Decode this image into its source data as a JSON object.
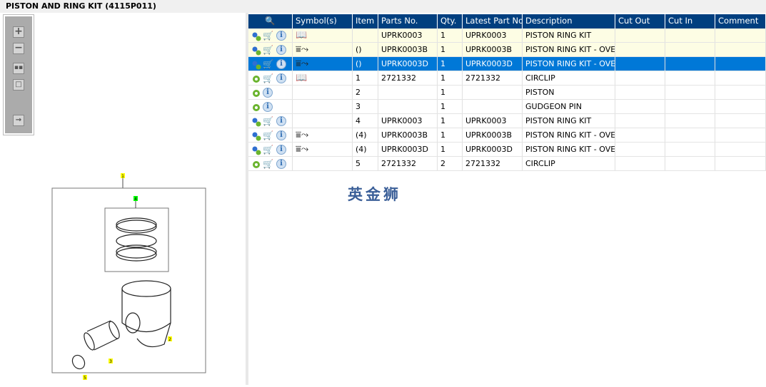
{
  "title": "PISTON AND RING KIT (4115P011)",
  "toolbar": {
    "zoom_in": "+",
    "zoom_out": "−"
  },
  "grid": {
    "columns": [
      "Symbol(s)",
      "Item",
      "Parts No.",
      "Qty.",
      "Latest Part No.",
      "Description",
      "Cut Out",
      "Cut In",
      "Comment"
    ],
    "rows": [
      {
        "icons": "multi",
        "cart": true,
        "symbol": "book",
        "item": "",
        "part": "UPRK0003",
        "qty": "1",
        "latest": "UPRK0003",
        "desc": "PISTON RING KIT",
        "style": "yel"
      },
      {
        "icons": "multi",
        "cart": true,
        "symbol": "alt",
        "item": "()",
        "part": "UPRK0003B",
        "qty": "1",
        "latest": "UPRK0003B",
        "desc": "PISTON RING KIT - OVERSIZE",
        "style": "yel"
      },
      {
        "icons": "multi",
        "cart": true,
        "symbol": "alt",
        "item": "()",
        "part": "UPRK0003D",
        "qty": "1",
        "latest": "UPRK0003D",
        "desc": "PISTON RING KIT - OVERSIZE",
        "style": "sel"
      },
      {
        "icons": "single",
        "cart": true,
        "symbol": "book",
        "item": "1",
        "part": "2721332",
        "qty": "1",
        "latest": "2721332",
        "desc": "CIRCLIP",
        "style": ""
      },
      {
        "icons": "single",
        "cart": false,
        "symbol": "",
        "item": "2",
        "part": "",
        "qty": "1",
        "latest": "",
        "desc": "PISTON",
        "style": ""
      },
      {
        "icons": "single",
        "cart": false,
        "symbol": "",
        "item": "3",
        "part": "",
        "qty": "1",
        "latest": "",
        "desc": "GUDGEON PIN",
        "style": ""
      },
      {
        "icons": "multi",
        "cart": true,
        "symbol": "",
        "item": "4",
        "part": "UPRK0003",
        "qty": "1",
        "latest": "UPRK0003",
        "desc": "PISTON RING KIT",
        "style": ""
      },
      {
        "icons": "multi",
        "cart": true,
        "symbol": "alt",
        "item": "(4)",
        "part": "UPRK0003B",
        "qty": "1",
        "latest": "UPRK0003B",
        "desc": "PISTON RING KIT - OVERSIZE",
        "style": ""
      },
      {
        "icons": "multi",
        "cart": true,
        "symbol": "alt",
        "item": "(4)",
        "part": "UPRK0003D",
        "qty": "1",
        "latest": "UPRK0003D",
        "desc": "PISTON RING KIT - OVERSIZE",
        "style": ""
      },
      {
        "icons": "single",
        "cart": true,
        "symbol": "",
        "item": "5",
        "part": "2721332",
        "qty": "2",
        "latest": "2721332",
        "desc": "CIRCLIP",
        "style": ""
      }
    ]
  },
  "watermark": "英金狮",
  "callouts": [
    "1",
    "4",
    "2",
    "3",
    "5"
  ]
}
